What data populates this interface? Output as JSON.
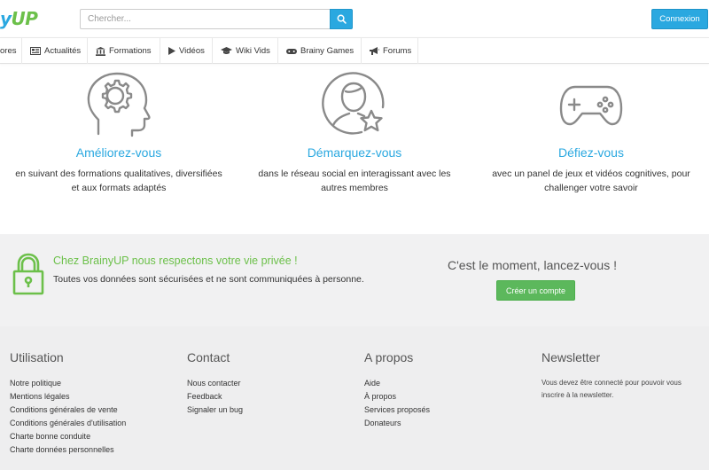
{
  "header": {
    "logo_part1": "y",
    "logo_part2": "UP",
    "search_placeholder": "Chercher...",
    "login_label": "Connexion"
  },
  "nav": [
    {
      "label": "ores",
      "icon": ""
    },
    {
      "label": "Actualités",
      "icon": "newspaper-icon"
    },
    {
      "label": "Formations",
      "icon": "institution-icon"
    },
    {
      "label": "Vidéos",
      "icon": "play-icon"
    },
    {
      "label": "Wiki Vids",
      "icon": "graduation-cap-icon"
    },
    {
      "label": "Brainy Games",
      "icon": "gamepad-icon"
    },
    {
      "label": "Forums",
      "icon": "bullhorn-icon"
    }
  ],
  "features": [
    {
      "title": "Améliorez-vous",
      "text": "en suivant des formations qualitatives, diversifiées et aux formats adaptés",
      "color": "#2aa8e0",
      "icon": "brain-gear-icon"
    },
    {
      "title": "Démarquez-vous",
      "text": "dans le réseau social en interagissant avec les autres membres",
      "color": "#2aa8e0",
      "icon": "user-star-icon"
    },
    {
      "title": "Défiez-vous",
      "text": "avec un panel de jeux et vidéos cognitives, pour challenger votre savoir",
      "color": "#2aa8e0",
      "icon": "gamepad-icon"
    }
  ],
  "privacy": {
    "title": "Chez BrainyUP nous respectons votre vie privée !",
    "text": "Toutes vos données sont sécurisées et ne sont communiquées à personne.",
    "cta_title": "C'est le moment, lancez-vous !",
    "cta_button": "Créer un compte"
  },
  "footer": {
    "utilisation": {
      "title": "Utilisation",
      "links": [
        "Notre politique",
        "Mentions légales",
        "Conditions générales de vente",
        "Conditions générales d'utilisation",
        "Charte bonne conduite",
        "Charte données personnelles"
      ]
    },
    "contact": {
      "title": "Contact",
      "links": [
        "Nous contacter",
        "Feedback",
        "Signaler un bug"
      ]
    },
    "apropos": {
      "title": "A propos",
      "links": [
        "Aide",
        "À propos",
        "Services proposés",
        "Donateurs"
      ]
    },
    "newsletter": {
      "title": "Newsletter",
      "text": "Vous devez être connecté pour pouvoir vous inscrire à la newsletter."
    }
  },
  "colors": {
    "blue": "#2aa8e0",
    "green": "#6cc04a",
    "button_green": "#5cb85c"
  }
}
